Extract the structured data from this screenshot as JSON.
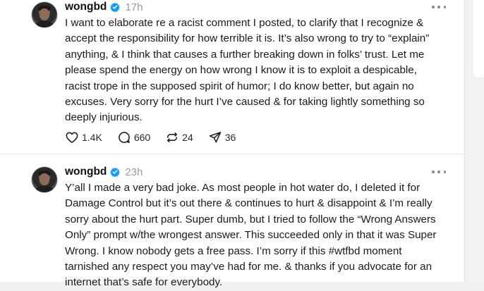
{
  "posts": [
    {
      "username": "wongbd",
      "timestamp": "17h",
      "lines": [
        "I want to elaborate re a racist comment I posted, to clarify that I recognize &",
        "accept the responsibility for how terrible it is. It’s also wrong to try to “explain”",
        "anything, & I think that causes a further breaking down in folks’ trust. Let me",
        "please spend the energy on how wrong I know it is to exploit a despicable,",
        "racist trope in the supposed spirit of humor; I do know better, but again no",
        "excuses. Very sorry for the hurt I’ve caused & for taking lightly something so",
        "deeply injurious."
      ],
      "likes": "1.4K",
      "replies": "660",
      "reposts": "24",
      "shares": "36"
    },
    {
      "username": "wongbd",
      "timestamp": "23h",
      "lines": [
        "Y’all I made a very bad joke. As most people in hot water do, I deleted it for",
        "Damage Control but it’s out there & continues to hurt & disappoint & I’m really",
        "sorry about the hurt part. Super dumb, but I tried to follow the “Wrong Answers",
        "Only” prompt w/the wrongest answer. This succeeded only in that it was Super",
        "Wrong. I know nobody gets a free pass. I’m sorry if this #wtfbd moment",
        "tarnished any respect you may’ve had for me. & thanks if you advocate for an",
        "internet that’s safe for everybody."
      ]
    }
  ],
  "icons": {
    "like": "heart-icon",
    "reply": "comment-icon",
    "repost": "repost-icon",
    "share": "send-icon",
    "verified": "verified-badge-icon",
    "more": "more-options-icon"
  },
  "colors": {
    "verified": "#1d9bf0",
    "muted": "#9a9a9a",
    "text": "#1a1a1a"
  }
}
